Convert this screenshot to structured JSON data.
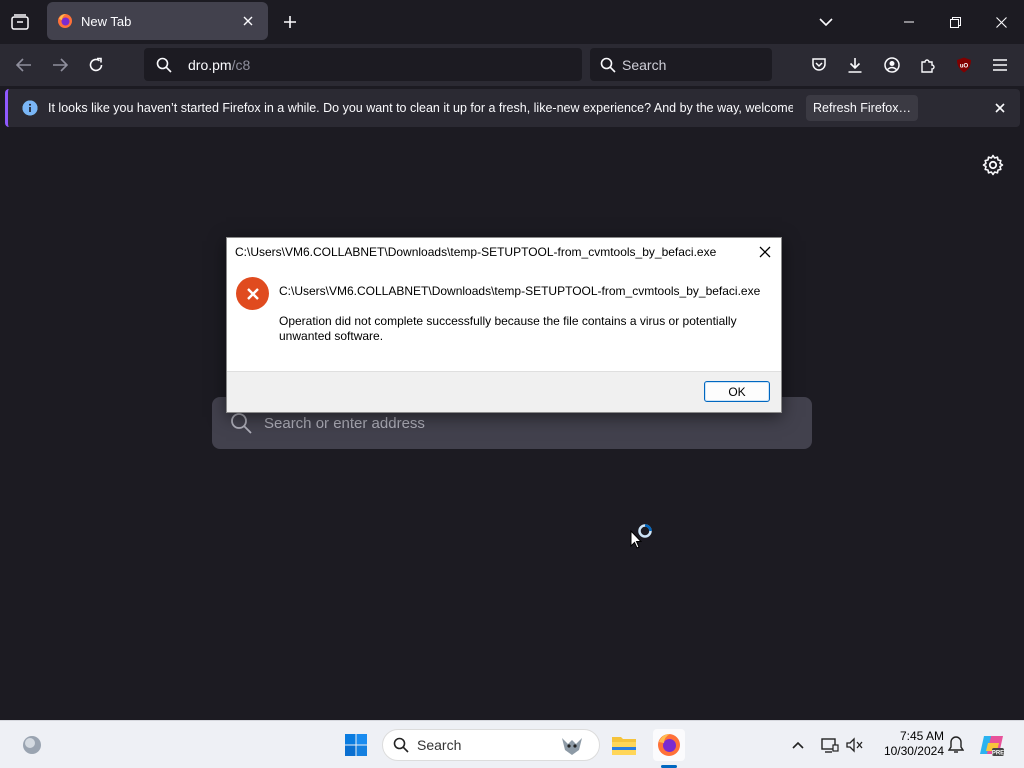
{
  "browser": {
    "tab": {
      "title": "New Tab"
    },
    "url": {
      "host": "dro.pm",
      "path": "/c8"
    },
    "search_placeholder": "Search"
  },
  "notification": {
    "message": "It looks like you haven’t started Firefox in a while. Do you want to clean it up for a fresh, like-new experience? And by the way, welcome back!",
    "button_label": "Refresh Firefox…"
  },
  "newtab": {
    "search_placeholder": "Search or enter address"
  },
  "dialog": {
    "title": "C:\\Users\\VM6.COLLABNET\\Downloads\\temp-SETUPTOOL-from_cvmtools_by_befaci.exe",
    "path": "C:\\Users\\VM6.COLLABNET\\Downloads\\temp-SETUPTOOL-from_cvmtools_by_befaci.exe",
    "message": "Operation did not complete successfully because the file contains a virus or potentially unwanted software.",
    "ok_label": "OK"
  },
  "taskbar": {
    "search_label": "Search",
    "time": "7:45 AM",
    "date": "10/30/2024"
  },
  "colors": {
    "accent": "#9059ff",
    "error": "#e04b1f",
    "win_accent": "#0067c0"
  }
}
